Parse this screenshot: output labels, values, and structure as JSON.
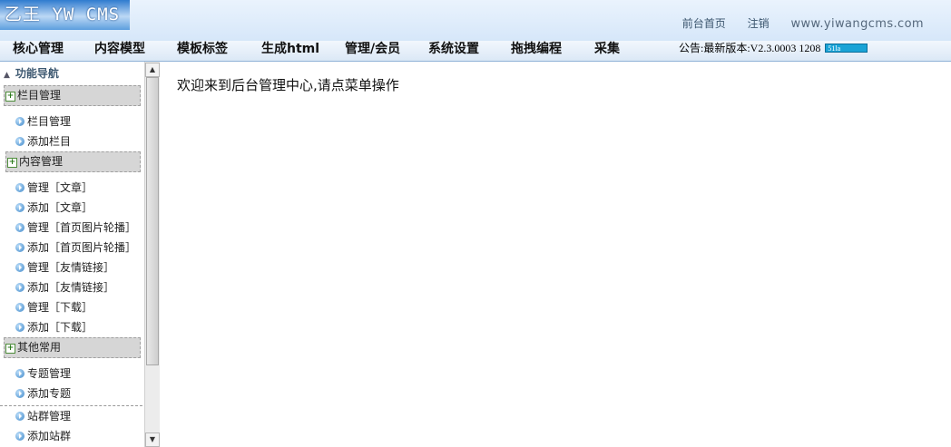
{
  "header": {
    "logo": "乙王 YW CMS",
    "links": [
      "前台首页",
      "注销"
    ],
    "site": "www.yiwangcms.com"
  },
  "menu": {
    "items": [
      "核心管理",
      "内容模型",
      "模板标签",
      "生成html",
      "管理/会员",
      "系统设置",
      "拖拽编程",
      "采集"
    ],
    "notice": "公告:最新版本:V2.3.0003 1208",
    "badge": "51la"
  },
  "sidebar": {
    "title": "功能导航",
    "groups": [
      {
        "label": "栏目管理",
        "items": [
          "栏目管理",
          "添加栏目"
        ]
      },
      {
        "label": "内容管理",
        "items": [
          "管理［文章］",
          "添加［文章］",
          "管理［首页图片轮播］",
          "添加［首页图片轮播］",
          "管理［友情链接］",
          "添加［友情链接］",
          "管理［下载］",
          "添加［下载］"
        ]
      },
      {
        "label": "其他常用",
        "items": [
          "专题管理",
          "添加专题",
          "站群管理",
          "添加站群"
        ]
      }
    ]
  },
  "main": {
    "welcome": "欢迎来到后台管理中心,请点菜单操作"
  }
}
